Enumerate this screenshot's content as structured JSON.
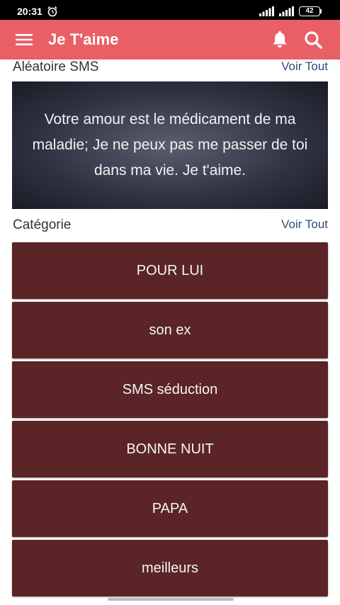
{
  "status_bar": {
    "time": "20:31",
    "battery": "42",
    "icons": [
      "alarm-icon",
      "signal-icon",
      "signal-icon",
      "battery-icon"
    ]
  },
  "app_bar": {
    "title": "Je T'aime",
    "background_color": "#e86066",
    "icons": [
      "menu-icon",
      "bell-icon",
      "search-icon"
    ]
  },
  "random_sms": {
    "section_title": "Aléatoire SMS",
    "see_all": "Voir Tout",
    "message": "Votre amour est le médicament de ma maladie; Je ne peux pas me passer de toi dans ma vie. Je t'aime."
  },
  "categories": {
    "section_title": "Catégorie",
    "see_all": "Voir Tout",
    "item_color": "#5b2427",
    "items": [
      {
        "label": "POUR LUI"
      },
      {
        "label": "son ex"
      },
      {
        "label": "SMS séduction"
      },
      {
        "label": "BONNE NUIT"
      },
      {
        "label": "PAPA"
      },
      {
        "label": "meilleurs"
      }
    ]
  }
}
